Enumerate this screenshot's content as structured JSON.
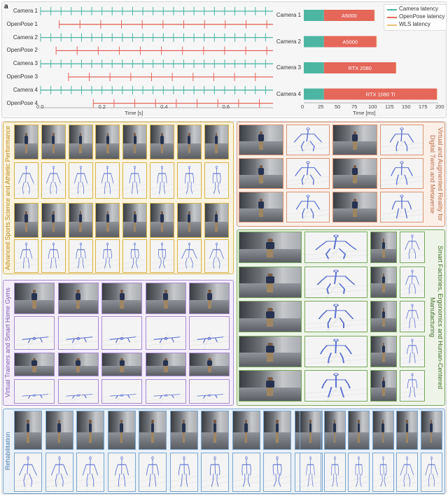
{
  "panel_a": {
    "label": "a",
    "timeline": {
      "rows": [
        "Camera 1",
        "OpenPose 1",
        "Camera 2",
        "OpenPose 2",
        "Camera 3",
        "OpenPose 3",
        "Camera 4",
        "OpenPose 4"
      ],
      "x_ticks": [
        "0.0",
        "0.2",
        "0.4",
        "0.6"
      ],
      "x_label": "Time [s]",
      "colors": {
        "camera": "#4db6a3",
        "openpose": "#e4675a"
      }
    },
    "latency": {
      "x_ticks": [
        "0",
        "25",
        "50",
        "75",
        "100",
        "125",
        "150",
        "175",
        "200"
      ],
      "x_label": "Time [ms]",
      "legend": [
        "Camera latency",
        "OpenPose latency",
        "WLS latency"
      ],
      "colors": {
        "camera": "#4db6a3",
        "openpose": "#e4675a",
        "wls": "#e9c46a"
      }
    }
  },
  "chart_data": [
    {
      "type": "bar",
      "orientation": "horizontal",
      "stacked": true,
      "categories": [
        "Camera 1",
        "Camera 2",
        "Camera 3",
        "Camera 4"
      ],
      "series": [
        {
          "name": "Camera latency",
          "values": [
            30,
            30,
            30,
            30
          ]
        },
        {
          "name": "OpenPose latency",
          "values": [
            75,
            78,
            107,
            168
          ]
        },
        {
          "name": "WLS latency",
          "values": [
            0.5,
            0.5,
            0.5,
            0.5
          ]
        }
      ],
      "bar_annotations": [
        "A5000",
        "A5000",
        "RTX 2080",
        "RTX 1080 Ti"
      ],
      "xlabel": "Time [ms]",
      "xlim": [
        0,
        200
      ],
      "legend_position": "top-right"
    },
    {
      "type": "scatter",
      "title": "",
      "xlabel": "Time [s]",
      "xlim": [
        0,
        0.75
      ],
      "rows": [
        "Camera 1",
        "OpenPose 1",
        "Camera 2",
        "OpenPose 2",
        "Camera 3",
        "OpenPose 3",
        "Camera 4",
        "OpenPose 4"
      ],
      "series": [
        {
          "start": 0.0,
          "end": 0.75,
          "period": 0.033
        },
        {
          "start": 0.06,
          "end": 0.75,
          "period": 0.067
        },
        {
          "start": 0.0,
          "end": 0.75,
          "period": 0.033
        },
        {
          "start": 0.05,
          "end": 0.75,
          "period": 0.068
        },
        {
          "start": 0.0,
          "end": 0.75,
          "period": 0.033
        },
        {
          "start": 0.09,
          "end": 0.75,
          "period": 0.067
        },
        {
          "start": 0.0,
          "end": 0.75,
          "period": 0.033
        },
        {
          "start": 0.17,
          "end": 0.75,
          "period": 0.067
        }
      ]
    }
  ],
  "panel_b": {
    "label": "b",
    "sections": {
      "sports": {
        "title": "Advanced Sports Science and Athletic Performance",
        "border": "#d9b44a",
        "fill": "#fbf3dd"
      },
      "vr": {
        "title": "Virtual and Augmented Reality for Digital Twins and Metaverse",
        "border": "#d99575",
        "fill": "#fcefe8"
      },
      "factory": {
        "title": "Smart Factories, Ergonomics and Human-Centered Manufacturing",
        "border": "#79a85f",
        "fill": "#eef5e8"
      },
      "trainer": {
        "title": "Virtual Trainers and Smart Home Gyms",
        "border": "#a98ad1",
        "fill": "#f3eefa"
      },
      "rehab": {
        "title": "Rehabilitation",
        "border": "#7ba6cf",
        "fill": "#eaf1f8"
      }
    }
  }
}
